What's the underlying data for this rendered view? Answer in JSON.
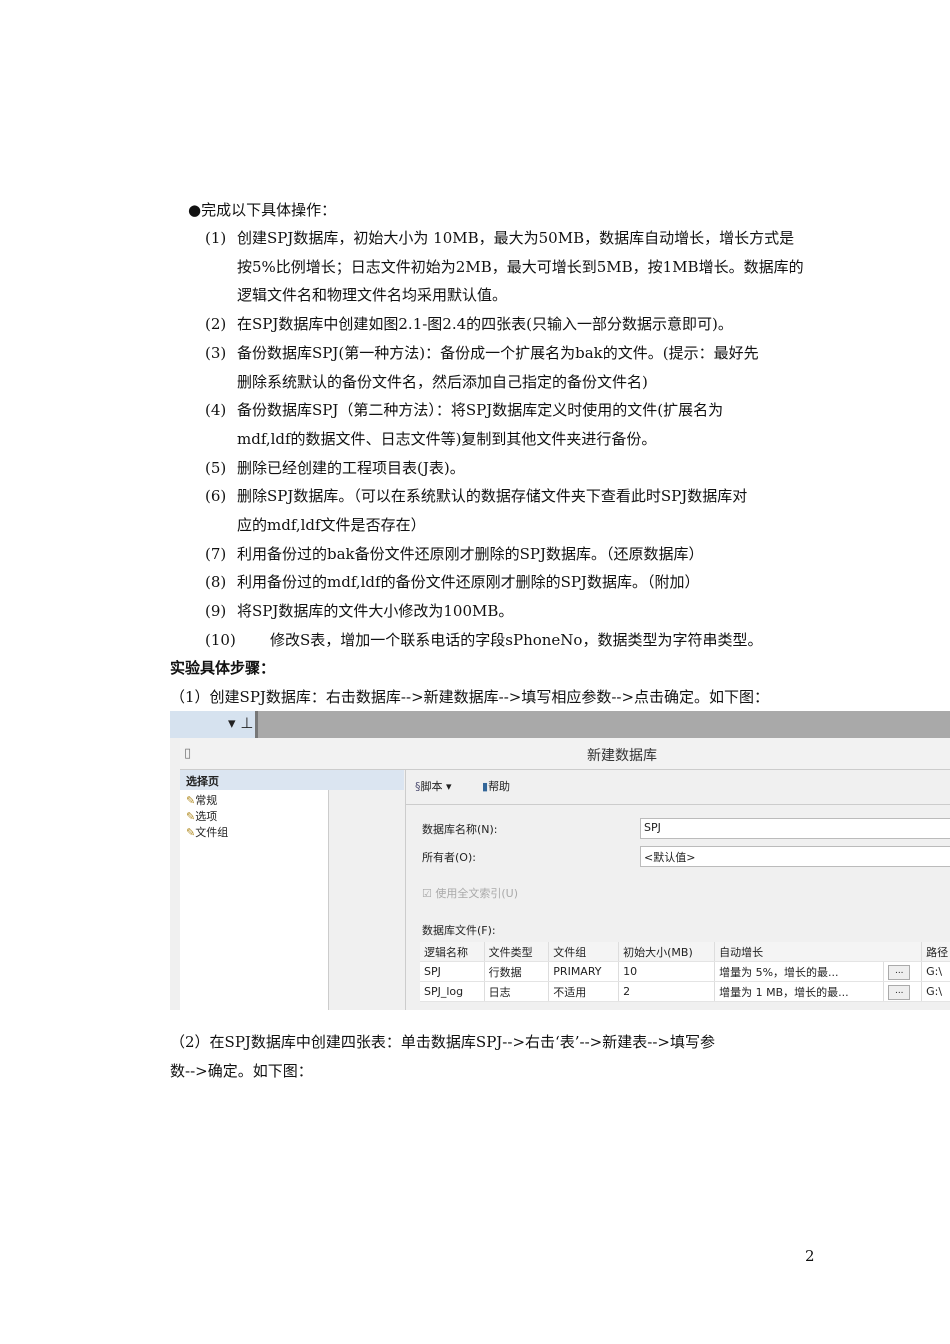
{
  "bullet_heading": "完成以下具体操作：",
  "tasks": [
    {
      "num": "(1)",
      "lines": [
        "创建SPJ数据库，初始大小为 10MB，最大为50MB，数据库自动增长，增长方式是",
        "按5%比例增长；日志文件初始为2MB，最大可增长到5MB，按1MB增长。数据库的",
        "逻辑文件名和物理文件名均采用默认值。"
      ]
    },
    {
      "num": "(2)",
      "lines": [
        "在SPJ数据库中创建如图2.1-图2.4的四张表(只输入一部分数据示意即可)。"
      ]
    },
    {
      "num": "(3)",
      "lines": [
        "备份数据库SPJ(第一种方法)：备份成一个扩展名为bak的文件。(提示：最好先",
        "删除系统默认的备份文件名，然后添加自己指定的备份文件名)"
      ]
    },
    {
      "num": "(4)",
      "lines": [
        "备份数据库SPJ（第二种方法）：将SPJ数据库定义时使用的文件(扩展名为",
        "mdf,ldf的数据文件、日志文件等)复制到其他文件夹进行备份。"
      ]
    },
    {
      "num": "(5)",
      "lines": [
        "删除已经创建的工程项目表(J表)。"
      ]
    },
    {
      "num": "(6)",
      "lines": [
        "删除SPJ数据库。（可以在系统默认的数据存储文件夹下查看此时SPJ数据库对",
        "应的mdf,ldf文件是否存在）"
      ]
    },
    {
      "num": "(7)",
      "lines": [
        "利用备份过的bak备份文件还原刚才删除的SPJ数据库。（还原数据库）"
      ]
    },
    {
      "num": "(8)",
      "lines": [
        "利用备份过的mdf,ldf的备份文件还原刚才删除的SPJ数据库。（附加）"
      ]
    },
    {
      "num": "(9)",
      "lines": [
        "将SPJ数据库的文件大小修改为100MB。"
      ]
    },
    {
      "num": "(10)",
      "lines": [
        "修改S表，增加一个联系电话的字段sPhoneNo，数据类型为字符串类型。"
      ]
    }
  ],
  "steps_heading": "实验具体步骤：",
  "step1": "（1）创建SPJ数据库：右击数据库-->新建数据库-->填写相应参数-->点击确定。如下图：",
  "step2_lines": [
    "（2）在SPJ数据库中创建四张表：单击数据库SPJ-->右击‘表’-->新建表-->填写参",
    "数-->确定。如下图："
  ],
  "page_number": "2",
  "screenshot": {
    "dialog_title": "新建数据库",
    "select_page": "选择页",
    "pages": [
      "常规",
      "选项",
      "文件组"
    ],
    "script": "脚本",
    "help": "帮助",
    "db_name_label": "数据库名称(N):",
    "db_name_value": "SPJ",
    "owner_label": "所有者(O):",
    "owner_value": "<默认值>",
    "fulltext_label": "使用全文索引(U)",
    "files_label": "数据库文件(F):",
    "columns": [
      "逻辑名称",
      "文件类型",
      "文件组",
      "初始大小(MB)",
      "自动增长",
      "路径"
    ],
    "rows": [
      [
        "SPJ",
        "行数据",
        "PRIMARY",
        "10",
        "增量为 5%，增长的最...",
        "G:\\"
      ],
      [
        "SPJ_log",
        "日志",
        "不适用",
        "2",
        "增量为 1 MB，增长的最...",
        "G:\\"
      ]
    ],
    "ellipsis": "..."
  }
}
